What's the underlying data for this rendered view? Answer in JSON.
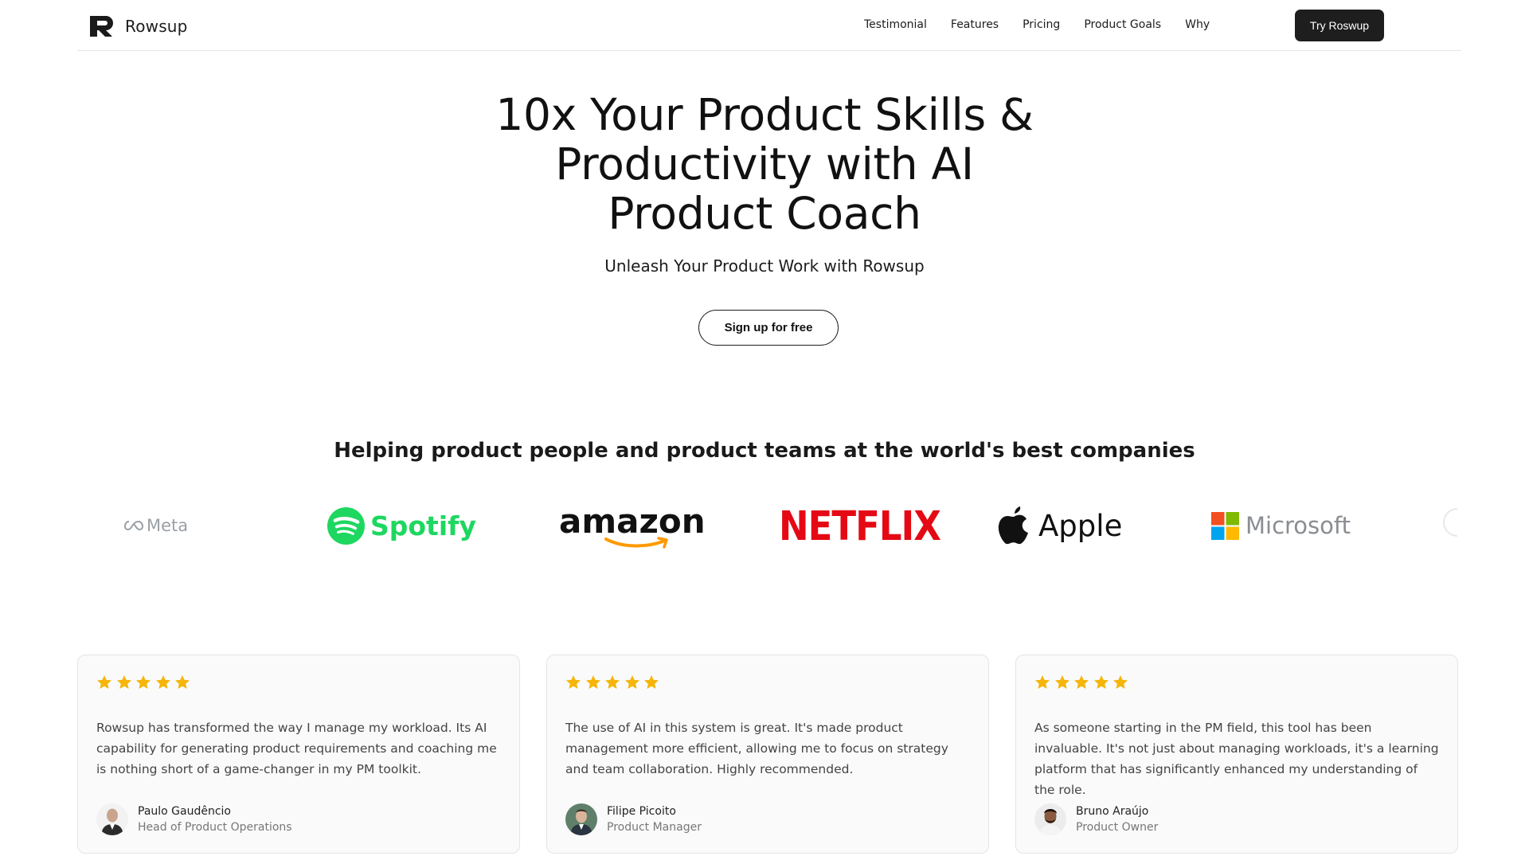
{
  "brand": {
    "name": "Rowsup",
    "logo_icon": "rowsup-r-logo"
  },
  "nav": {
    "items": [
      {
        "label": "Testimonial"
      },
      {
        "label": "Features"
      },
      {
        "label": "Pricing"
      },
      {
        "label": "Product Goals"
      },
      {
        "label": "Why"
      }
    ],
    "cta_label": "Try Roswup"
  },
  "hero": {
    "title_lines": [
      "10x Your Product Skills &",
      "Productivity with AI",
      "Product Coach"
    ],
    "subtitle": "Unleash Your Product Work with Rowsup",
    "cta_label": "Sign up for free"
  },
  "companies": {
    "heading": "Helping product people and product teams at the world's best companies",
    "logos": [
      {
        "name": "Meta",
        "icon": "meta-logo",
        "color": "#9aa0a6"
      },
      {
        "name": "Spotify",
        "icon": "spotify-logo",
        "color": "#1ed760"
      },
      {
        "name": "amazon",
        "icon": "amazon-logo",
        "color": "#ff9900"
      },
      {
        "name": "NETFLIX",
        "icon": "netflix-logo",
        "color": "#e50914"
      },
      {
        "name": "Apple",
        "icon": "apple-logo",
        "color": "#111111"
      },
      {
        "name": "Microsoft",
        "icon": "microsoft-logo",
        "color": "#8a8d91"
      }
    ]
  },
  "testimonials": [
    {
      "rating": 5,
      "quote": "Rowsup has transformed the way I manage my workload. Its AI capability for generating product requirements and coaching me is nothing short of a game-changer in my PM toolkit.",
      "name": "Paulo Gaudêncio",
      "role": "Head of Product Operations"
    },
    {
      "rating": 5,
      "quote": "The use of AI in this system is great. It's made product management more efficient, allowing me to focus on strategy and team collaboration. Highly recommended.",
      "name": "Filipe Picoito",
      "role": "Product Manager"
    },
    {
      "rating": 5,
      "quote": "As someone starting in the PM field, this tool has been invaluable. It's not just about managing workloads, it's a learning platform that has significantly enhanced my understanding of the role.",
      "name": "Bruno Araújo",
      "role": "Product Owner"
    }
  ],
  "colors": {
    "star": "#f5b50a",
    "dark_button": "#1e1e1e",
    "border": "#e5e5e5"
  }
}
